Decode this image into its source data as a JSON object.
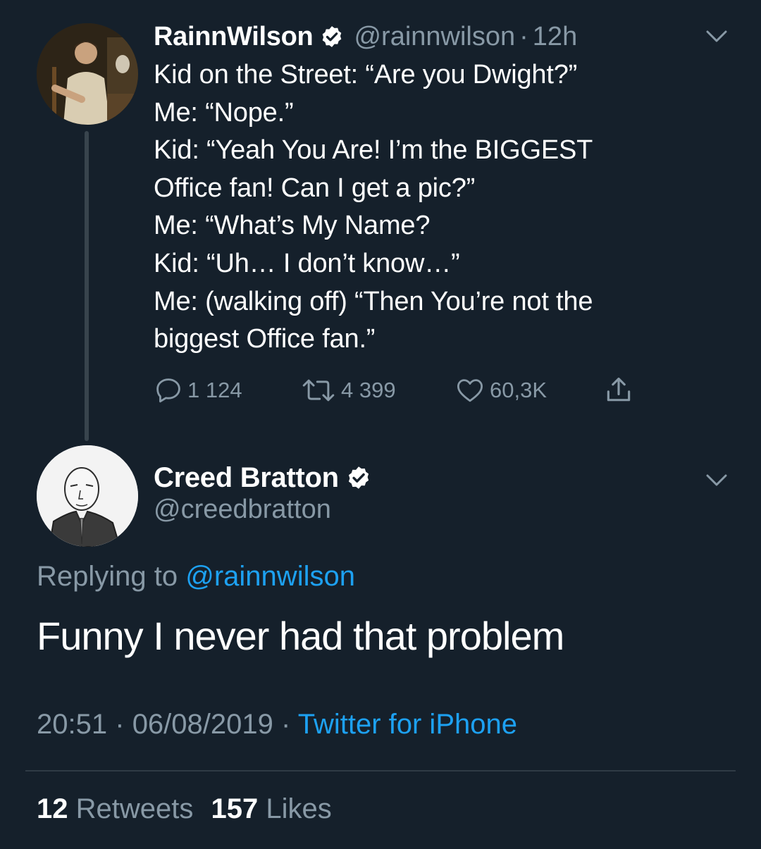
{
  "theme": {
    "background": "#15202b",
    "text_primary": "#ffffff",
    "text_secondary": "#8899a6",
    "accent": "#1da1f2",
    "verified_badge": "#ffffff"
  },
  "parent_tweet": {
    "author_name": "RainnWilson",
    "verified": true,
    "handle": "@rainnwilson",
    "separator": "·",
    "time_ago": "12h",
    "lines": [
      "Kid on the Street: “Are you Dwight?”",
      "Me: “Nope.”",
      "Kid: “Yeah You Are! I’m the BIGGEST",
      "Office fan! Can I get a pic?”",
      "Me: “What’s My Name?",
      "Kid: “Uh… I don’t know…”",
      "Me: (walking off) “Then You’re not the",
      "biggest Office fan.”"
    ],
    "actions": {
      "reply_icon": "speech-bubble-icon",
      "reply_count": "1 124",
      "retweet_icon": "retweet-icon",
      "retweet_count": "4 399",
      "like_icon": "heart-icon",
      "like_count": "60,3K",
      "share_icon": "share-icon"
    }
  },
  "reply_tweet": {
    "author_name": "Creed Bratton",
    "verified": true,
    "handle": "@creedbratton",
    "replying_prefix": "Replying to",
    "replying_handle": "@rainnwilson",
    "text": "Funny I never had that problem",
    "time": "20:51",
    "date": "06/08/2019",
    "separator": "·",
    "source": "Twitter for iPhone",
    "retweets_count": "12",
    "retweets_label": "Retweets",
    "likes_count": "157",
    "likes_label": "Likes"
  }
}
